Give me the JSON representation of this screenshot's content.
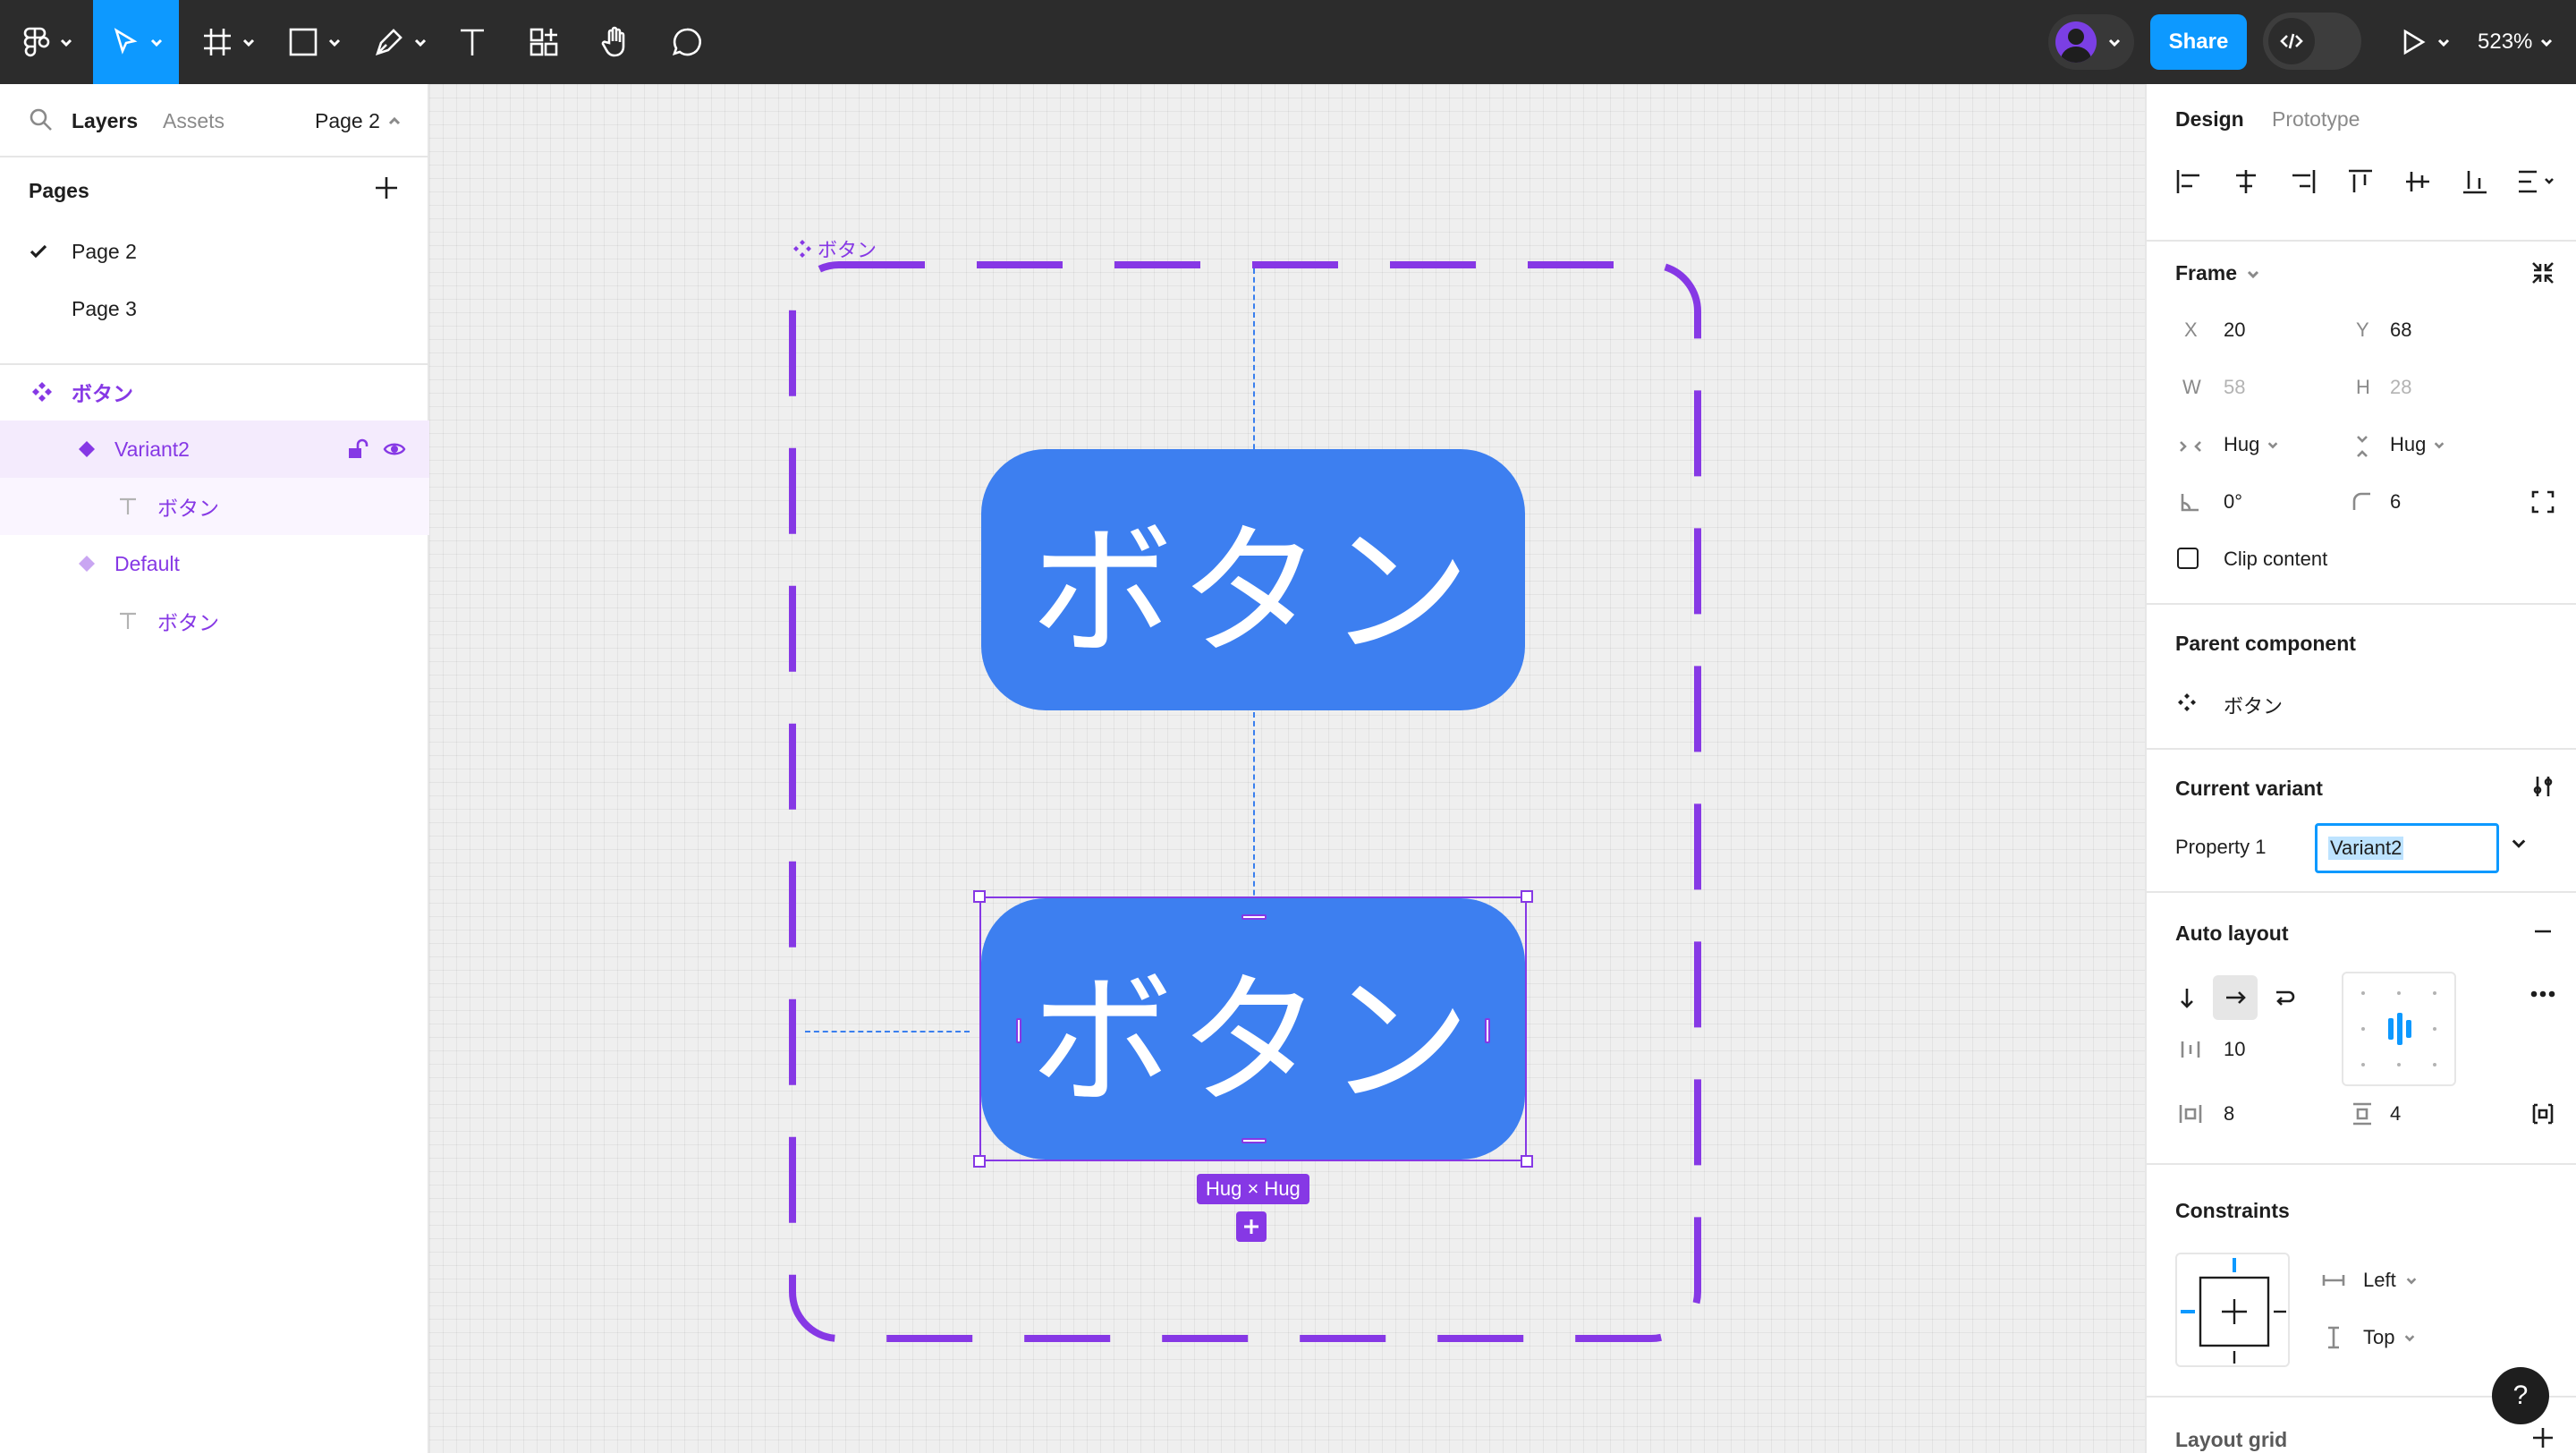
{
  "toolbar": {
    "tools": [
      {
        "name": "main-menu",
        "icon": "figma-logo-icon"
      },
      {
        "name": "move-tool",
        "icon": "cursor-icon",
        "active": true
      },
      {
        "name": "frame-tool",
        "icon": "frame-hash-icon"
      },
      {
        "name": "shape-tool",
        "icon": "rectangle-icon"
      },
      {
        "name": "pen-tool",
        "icon": "pen-icon"
      },
      {
        "name": "text-tool",
        "icon": "text-t-icon"
      },
      {
        "name": "resources-tool",
        "icon": "components-icon"
      },
      {
        "name": "hand-tool",
        "icon": "hand-icon"
      },
      {
        "name": "comment-tool",
        "icon": "comment-bubble-icon"
      }
    ],
    "share_label": "Share",
    "dev_mode_icon": "code-icon",
    "present_icon": "play-icon",
    "zoom": "523%",
    "accent_color": "#0d99ff"
  },
  "left_panel": {
    "tabs": {
      "layers": "Layers",
      "assets": "Assets"
    },
    "page_selector": "Page 2",
    "pages_header": "Pages",
    "pages": [
      {
        "label": "Page 2",
        "current": true
      },
      {
        "label": "Page 3",
        "current": false
      }
    ],
    "layers": [
      {
        "label": "ボタン",
        "icon": "component-set-icon",
        "level": 0
      },
      {
        "label": "Variant2",
        "icon": "variant-diamond-icon",
        "level": 1,
        "selected": true
      },
      {
        "label": "ボタン",
        "icon": "text-layer-icon",
        "level": 2
      },
      {
        "label": "Default",
        "icon": "variant-diamond-icon",
        "level": 1
      },
      {
        "label": "ボタン",
        "icon": "text-layer-icon",
        "level": 2
      }
    ]
  },
  "canvas": {
    "component_set_label": "ボタン",
    "buttons": [
      {
        "variant": "Default",
        "text": "ボタン"
      },
      {
        "variant": "Variant2",
        "text": "ボタン",
        "selected": true
      }
    ],
    "size_badge": "Hug × Hug",
    "component_color": "#8638e5",
    "button_color": "#3d7ff0"
  },
  "right_panel": {
    "tabs": {
      "design": "Design",
      "prototype": "Prototype"
    },
    "frame": {
      "title": "Frame",
      "x_label": "X",
      "x": "20",
      "y_label": "Y",
      "y": "68",
      "w_label": "W",
      "w": "58",
      "h_label": "H",
      "h": "28",
      "width_mode": "Hug",
      "height_mode": "Hug",
      "rotation": "0°",
      "radius": "6",
      "clip_content": "Clip content"
    },
    "parent_component": {
      "title": "Parent component",
      "name": "ボタン"
    },
    "current_variant": {
      "title": "Current variant",
      "property_label": "Property 1",
      "value": "Variant2"
    },
    "auto_layout": {
      "title": "Auto layout",
      "gap": "10",
      "padding_h": "8",
      "padding_v": "4"
    },
    "constraints": {
      "title": "Constraints",
      "horizontal": "Left",
      "vertical": "Top"
    },
    "layout_grid": {
      "title": "Layout grid"
    }
  },
  "help_label": "?"
}
